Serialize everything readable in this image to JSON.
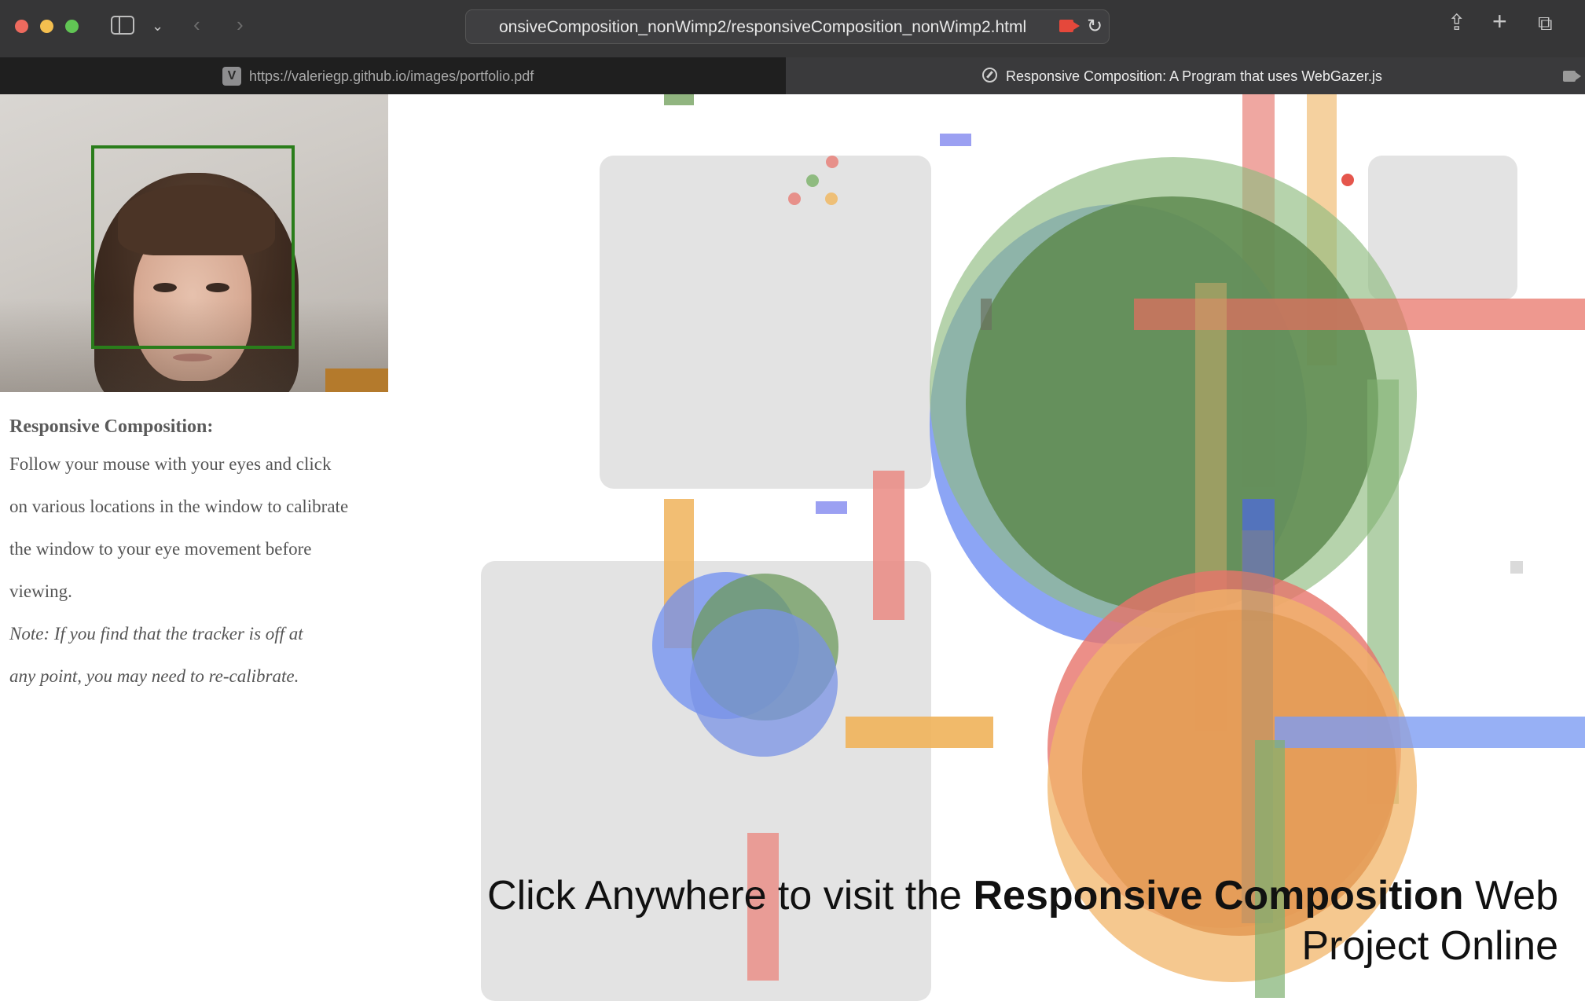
{
  "browser": {
    "address_url": "onsiveComposition_nonWimp2/responsiveComposition_nonWimp2.html",
    "tabs": [
      {
        "label": "https://valeriegp.github.io/images/portfolio.pdf",
        "favicon": "V",
        "active": false
      },
      {
        "label": "Responsive Composition: A Program that uses WebGazer.js",
        "active": true
      }
    ]
  },
  "sidebar_text": {
    "title": "Responsive Composition:",
    "lines": [
      "Follow your mouse with your eyes and click",
      "on various locations in the window to calibrate",
      "the window to your eye movement before",
      "viewing."
    ],
    "note_lines": [
      "Note: If you find that the tracker is off at",
      "any point, you may need to re-calibrate."
    ]
  },
  "cta": {
    "prefix": "Click Anywhere to visit the ",
    "bold": "Responsive Composition",
    "suffix_line1": " Web",
    "line2": "Project Online"
  },
  "colors": {
    "green": "#5e8a4f",
    "blue": "#6f8ff2",
    "red": "#ea8a82",
    "orange": "#eea64a",
    "panel_gray": "#e3e3e3",
    "face_box": "#2a7d1b"
  }
}
